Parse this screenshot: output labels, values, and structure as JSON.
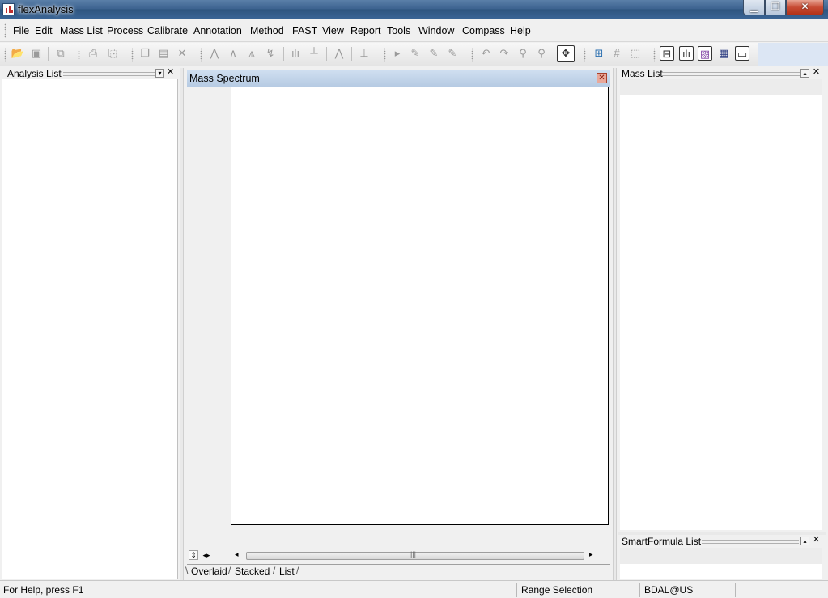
{
  "window": {
    "title": "flexAnalysis"
  },
  "menu": [
    "File",
    "Edit",
    "Mass List",
    "Process",
    "Calibrate",
    "Annotation",
    "Method",
    "FAST",
    "View",
    "Report",
    "Tools",
    "Window",
    "Compass",
    "Help"
  ],
  "panels": {
    "analysis_list": "Analysis List",
    "mass_spectrum": "Mass Spectrum",
    "mass_list": "Mass List",
    "smartformula_list": "SmartFormula List"
  },
  "tabs": [
    "Overlaid",
    "Stacked",
    "List"
  ],
  "status": {
    "help": "For Help, press F1",
    "mode": "Range Selection",
    "user": "BDAL@US"
  },
  "icons": [
    "open-folder-icon",
    "save-icon",
    "properties-icon",
    "print-preview-icon",
    "print-icon",
    "copy-icon",
    "paste-icon",
    "delete-icon",
    "peak-icon",
    "smooth-icon",
    "baseline-icon",
    "deconvolute-icon",
    "peak-pick-icon",
    "mass-pick-icon",
    "envelope-icon",
    "annotate-icon",
    "play-icon",
    "method-edit-icon",
    "method-check-icon",
    "method-run-icon",
    "zoom-undo-icon",
    "zoom-redo-icon",
    "zoom-in-icon",
    "zoom-out-icon",
    "pan-icon",
    "spectrum-view-icon",
    "grid-icon",
    "export-icon",
    "tree-view-icon",
    "bar-chart-icon",
    "image-icon",
    "table-icon",
    "console-icon"
  ]
}
